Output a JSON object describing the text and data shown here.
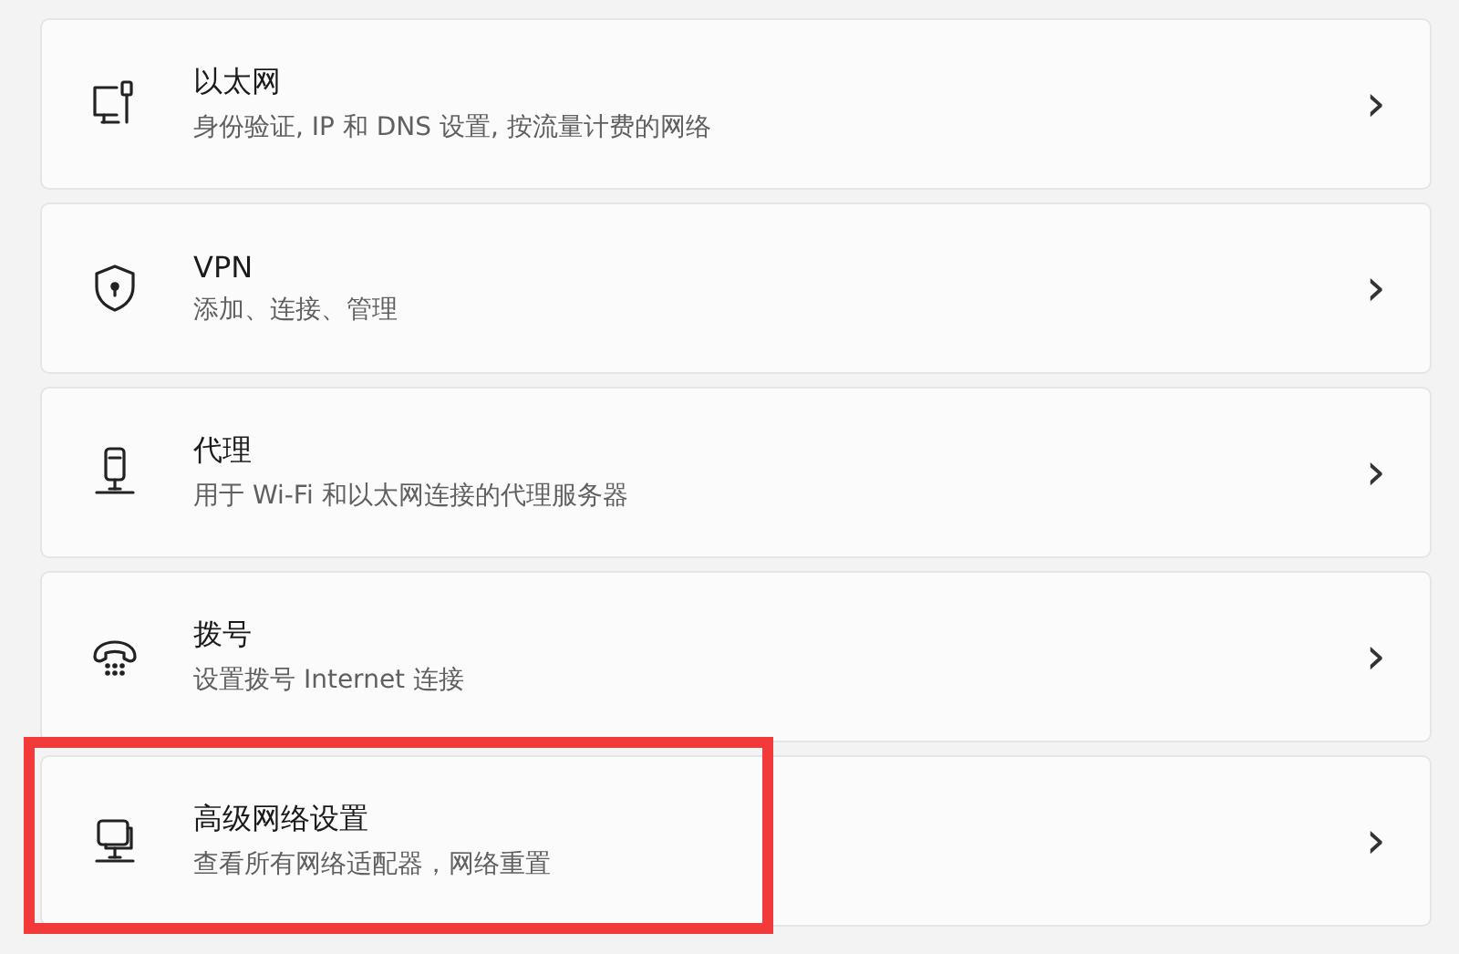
{
  "items": [
    {
      "kind": "ethernet",
      "title": "以太网",
      "subtitle": "身份验证, IP 和 DNS 设置, 按流量计费的网络",
      "chevron": "›",
      "highlighted": false
    },
    {
      "kind": "vpn",
      "title": "VPN",
      "subtitle": "添加、连接、管理",
      "chevron": "›",
      "highlighted": false
    },
    {
      "kind": "proxy",
      "title": "代理",
      "subtitle": "用于 Wi-Fi 和以太网连接的代理服务器",
      "chevron": "›",
      "highlighted": false
    },
    {
      "kind": "dialup",
      "title": "拨号",
      "subtitle": "设置拨号 Internet 连接",
      "chevron": "›",
      "highlighted": false
    },
    {
      "kind": "advanced",
      "title": "高级网络设置",
      "subtitle": "查看所有网络适配器，网络重置",
      "chevron": "›",
      "highlighted": true
    }
  ]
}
